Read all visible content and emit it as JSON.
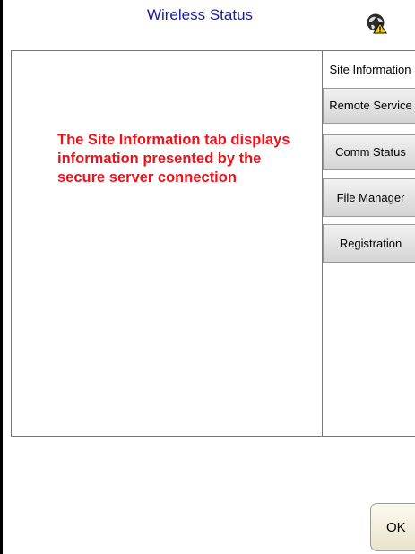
{
  "header": {
    "title": "Wireless Status",
    "status_icon": "globe-warning-icon"
  },
  "content": {
    "info_text": "The Site Information tab displays information presented by the secure server connection"
  },
  "tabs": [
    {
      "label": "Site Information",
      "active": true
    },
    {
      "label": "Remote Service",
      "active": false
    },
    {
      "label": "Comm Status",
      "active": false
    },
    {
      "label": "File Manager",
      "active": false
    },
    {
      "label": "Registration",
      "active": false
    }
  ],
  "footer": {
    "ok_label": "OK"
  },
  "colors": {
    "title": "#1a1aa6",
    "info_text": "#e8141c",
    "warning": "#f5c800"
  }
}
